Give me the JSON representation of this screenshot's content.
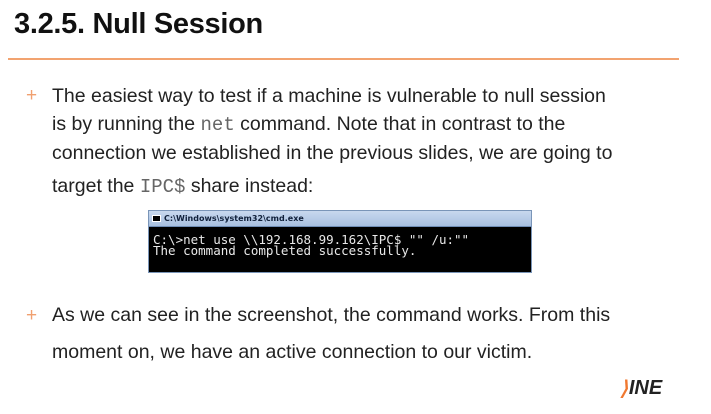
{
  "slide": {
    "title": "3.2.5. Null Session"
  },
  "bullets": [
    {
      "marker": "+",
      "segments": {
        "t1": "The easiest way to test if a machine is vulnerable to null session",
        "t2a": "is by running the ",
        "code1": "net",
        "t2b": " command. Note that in contrast to the",
        "t3": "connection we established in the previous slides, we are going to",
        "t4a": "target the ",
        "code2": "IPC$",
        "t4b": " share instead:"
      }
    },
    {
      "marker": "+",
      "segments": {
        "t1": "As we can see in the screenshot, the command works. From this",
        "t2": "moment on, we have an active connection to our victim."
      }
    }
  ],
  "cmd": {
    "title": "C:\\Windows\\system32\\cmd.exe",
    "line1": "C:\\>net use \\\\192.168.99.162\\IPC$ \"\" /u:\"\"",
    "line2": "The command completed successfully."
  },
  "logo": {
    "text": "INE"
  }
}
